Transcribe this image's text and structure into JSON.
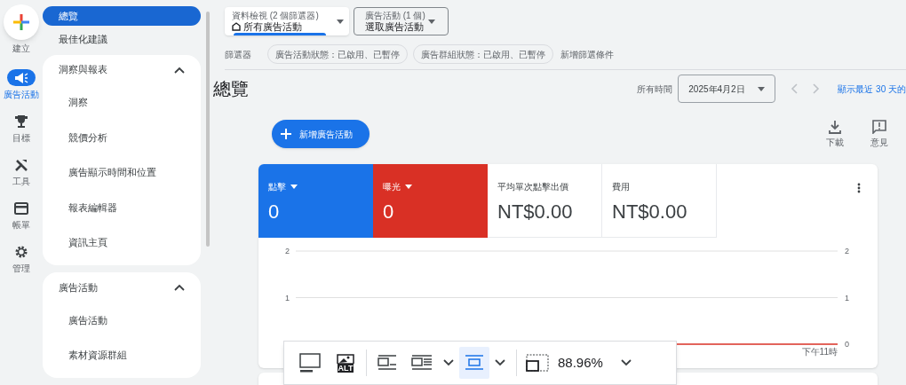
{
  "rail": {
    "create_label": "建立",
    "items": [
      {
        "label": "廣告活動",
        "selected": true
      },
      {
        "label": "目標",
        "selected": false
      },
      {
        "label": "工具",
        "selected": false
      },
      {
        "label": "帳單",
        "selected": false
      },
      {
        "label": "管理",
        "selected": false
      }
    ]
  },
  "nav": [
    {
      "kind": "link",
      "label": "總覽",
      "selected": true
    },
    {
      "kind": "link",
      "label": "最佳化建議",
      "selected": false
    },
    {
      "kind": "section",
      "label": "洞察與報表",
      "expanded": true,
      "children": [
        {
          "label": "洞察",
          "selected": false
        },
        {
          "label": "競價分析",
          "selected": false
        },
        {
          "label": "廣告顯示時間和位置",
          "selected": false
        },
        {
          "label": "報表編輯器",
          "selected": false
        },
        {
          "label": "資訊主頁",
          "selected": false
        }
      ]
    },
    {
      "kind": "section",
      "label": "廣告活動",
      "expanded": true,
      "children": [
        {
          "label": "廣告活動",
          "selected": false
        },
        {
          "label": "素材資源群組",
          "selected": false
        }
      ]
    }
  ],
  "header": {
    "view_selector": {
      "caption": "資料檢視 (2 個篩選器)",
      "value": "所有廣告活動"
    },
    "campaign_selector": {
      "caption": "廣告活動 (1 個)",
      "value": "選取廣告活動"
    },
    "filters_label": "篩選器",
    "filter_chips": [
      "廣告活動狀態：已啟用、已暫停",
      "廣告群組狀態：已啟用、已暫停"
    ],
    "add_filter": "新增篩選條件"
  },
  "page_title": "總覽",
  "date": {
    "label": "所有時間",
    "value": "2025年4月2日",
    "link": "顯示最近 30 天的"
  },
  "new_campaign_button": "新增廣告活動",
  "actions": [
    {
      "label": "下載"
    },
    {
      "label": "意見"
    }
  ],
  "metrics": [
    {
      "label": "點擊",
      "value": "0",
      "color": "#1a73e8",
      "dropdown": true
    },
    {
      "label": "曝光",
      "value": "0",
      "color": "#d93025",
      "dropdown": true
    },
    {
      "label": "平均單次點擊出價",
      "value": "NT$0.00",
      "dropdown": false
    },
    {
      "label": "費用",
      "value": "NT$0.00",
      "dropdown": false
    }
  ],
  "chart": {
    "left_axis_labels": [
      "2",
      "1"
    ],
    "right_axis_labels": [
      "2",
      "1",
      "0"
    ],
    "time_label": "下午11時"
  },
  "image_toolbar": {
    "alt_label": "ALT",
    "zoom": "88.96%",
    "tools": [
      {
        "selected": false
      },
      {
        "selected": false
      },
      {
        "selected": true
      }
    ]
  }
}
